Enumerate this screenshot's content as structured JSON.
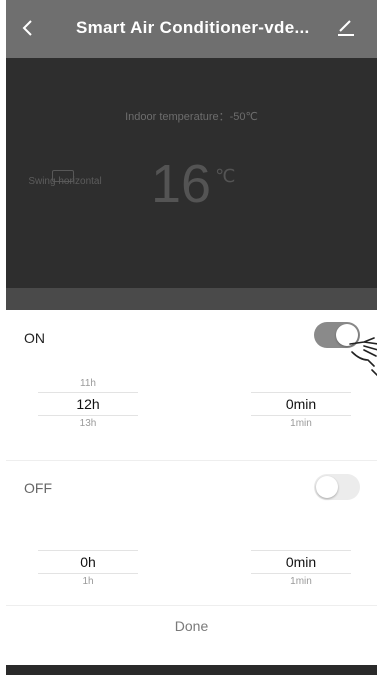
{
  "header": {
    "back_icon": "chevron-left-icon",
    "title": "Smart Air Conditioner-vde...",
    "edit_icon": "pencil-icon"
  },
  "device": {
    "indoor_text": "Indoor temperature：-50℃",
    "swing_label": "Swing horizontal",
    "temperature": "16",
    "temperature_unit": "℃"
  },
  "timer_on": {
    "label": "ON",
    "enabled": true,
    "hours": {
      "above": "11h",
      "selected": "12h",
      "below": "13h"
    },
    "minutes": {
      "selected": "0min",
      "below": "1min"
    }
  },
  "timer_off": {
    "label": "OFF",
    "enabled": false,
    "hours": {
      "selected": "0h",
      "below": "1h"
    },
    "minutes": {
      "selected": "0min",
      "below": "1min"
    }
  },
  "done_label": "Done",
  "colors": {
    "header_bg": "#6f6f6f",
    "device_bg": "#2e2e2e",
    "toggle_on": "#8a8a8a",
    "toggle_off": "#ececec"
  }
}
